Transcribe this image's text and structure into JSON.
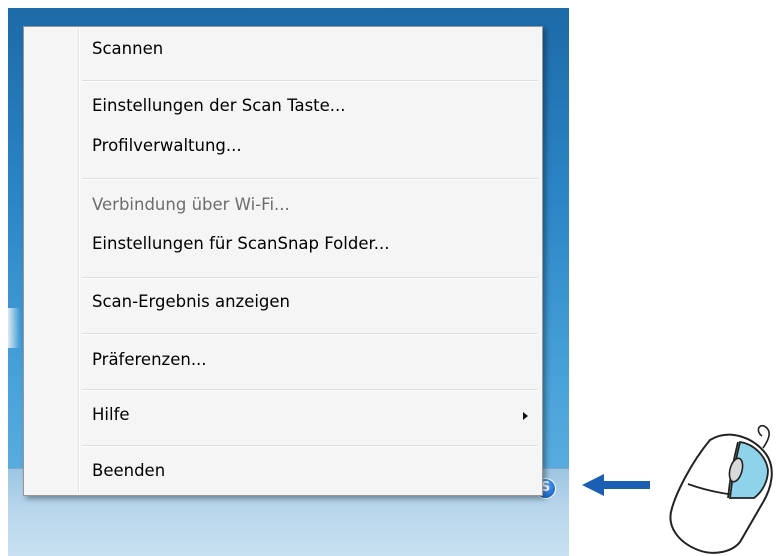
{
  "context_menu": {
    "items": [
      {
        "label": "Scannen",
        "enabled": true
      },
      {
        "label": "Einstellungen der Scan Taste...",
        "enabled": true
      },
      {
        "label": "Profilverwaltung...",
        "enabled": true
      },
      {
        "label": "Verbindung über Wi-Fi...",
        "enabled": false
      },
      {
        "label": "Einstellungen für ScanSnap Folder...",
        "enabled": true
      },
      {
        "label": "Scan-Ergebnis anzeigen",
        "enabled": true
      },
      {
        "label": "Präferenzen...",
        "enabled": true
      },
      {
        "label": "Hilfe",
        "enabled": true,
        "has_submenu": true
      },
      {
        "label": "Beenden",
        "enabled": true
      }
    ]
  },
  "taskbar": {
    "tray_icons": [
      "show-hidden-icons-arrow",
      "scansnap-manager-icon"
    ]
  },
  "annotation": {
    "arrow_color": "#1a5fb4",
    "mouse_button_highlight": "right",
    "mouse_highlight_color": "#8fd3ea"
  }
}
